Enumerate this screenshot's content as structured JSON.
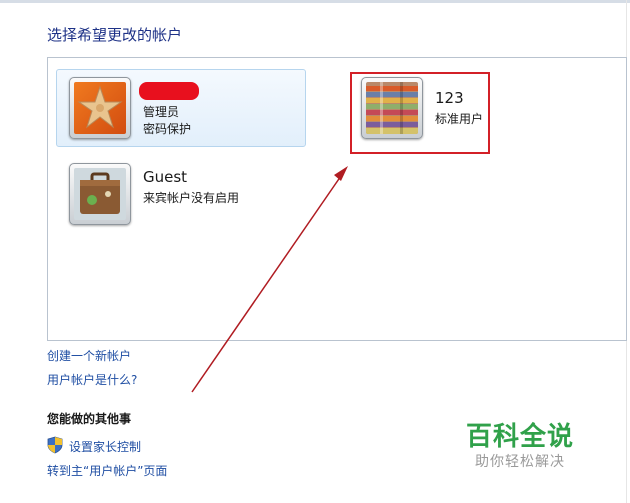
{
  "page": {
    "title": "选择希望更改的帐户"
  },
  "accounts": [
    {
      "name": "",
      "role": "管理员",
      "status": "密码保护",
      "avatar": "starfish-icon",
      "selected": true
    },
    {
      "name": "123",
      "role": "标准用户",
      "status": "",
      "avatar": "pencils-icon",
      "selected": false
    },
    {
      "name": "Guest",
      "role": "来宾帐户没有启用",
      "status": "",
      "avatar": "suitcase-icon",
      "selected": false
    }
  ],
  "links": {
    "create_account": "创建一个新帐户",
    "what_is_account": "用户帐户是什么?"
  },
  "other_tasks": {
    "heading": "您能做的其他事",
    "parental_controls": "设置家长控制",
    "go_main": "转到主“用户帐户”页面"
  },
  "watermark": {
    "title": "百科全说",
    "subtitle": "助你轻松解决"
  },
  "colors": {
    "title_blue": "#1e3287",
    "link_blue": "#1f4ea3",
    "highlight_red": "#d32027",
    "watermark_green": "#30a14a"
  }
}
